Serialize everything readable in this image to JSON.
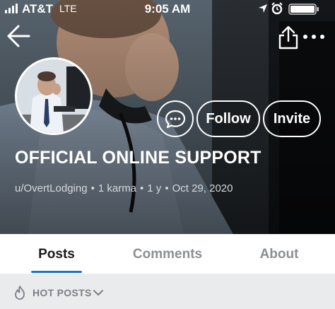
{
  "status_bar": {
    "carrier": "AT&T",
    "network": "LTE",
    "time": "9:05 AM"
  },
  "nav": {
    "back_icon": "arrow-left-icon",
    "share_icon": "share-icon",
    "more_icon": "more-horizontal-icon"
  },
  "profile": {
    "name": "OFFICIAL ONLINE SUPPORT",
    "username": "u/OvertLodging",
    "karma": "1 karma",
    "age": "1 y",
    "date": "Oct 29, 2020",
    "separator": "•"
  },
  "actions": {
    "chat_icon": "chat-bubble-icon",
    "follow": "Follow",
    "invite": "Invite"
  },
  "tabs": [
    {
      "label": "Posts",
      "active": true
    },
    {
      "label": "Comments",
      "active": false
    },
    {
      "label": "About",
      "active": false
    }
  ],
  "sort": {
    "label": "HOT POSTS",
    "icon": "flame-icon"
  },
  "colors": {
    "accent": "#1a74c9",
    "sort_bar_bg": "#e9ebed",
    "muted_text": "#8b8f93"
  }
}
